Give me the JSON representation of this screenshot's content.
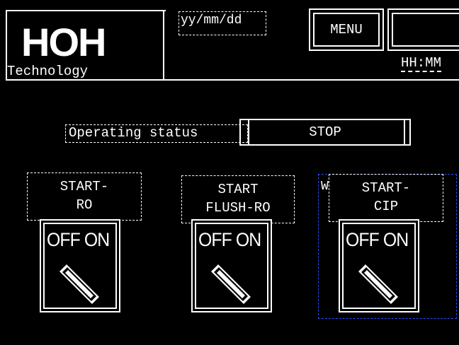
{
  "header": {
    "logo_text": "HOH",
    "logo_tagline": "Technology",
    "date": "yy/mm/dd",
    "menu_label": "MENU",
    "time": "HH:MM"
  },
  "status": {
    "label": "Operating status",
    "value": "STOP"
  },
  "switches": [
    {
      "label": "START-\nRO",
      "state_text": "OFF ON"
    },
    {
      "label": "START\nFLUSH-RO",
      "state_text": "OFF ON"
    },
    {
      "label": "START-\nCIP",
      "state_text": "OFF ON"
    }
  ],
  "marker": "W"
}
